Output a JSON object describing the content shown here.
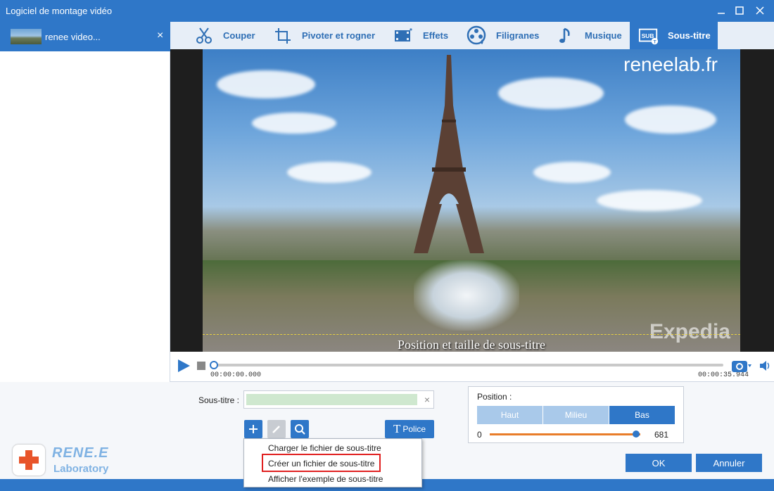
{
  "window": {
    "title": "Logiciel de montage vidéo"
  },
  "file_tab": {
    "name": "renee video...",
    "close": "×"
  },
  "toolbar": {
    "items": [
      {
        "label": "Couper",
        "icon": "scissors-icon"
      },
      {
        "label": "Pivoter et rogner",
        "icon": "crop-icon"
      },
      {
        "label": "Effets",
        "icon": "effects-icon"
      },
      {
        "label": "Filigranes",
        "icon": "watermark-icon"
      },
      {
        "label": "Musique",
        "icon": "music-icon"
      },
      {
        "label": "Sous-titre",
        "icon": "subtitle-icon",
        "active": true
      }
    ]
  },
  "video": {
    "watermark": "reneelab.fr",
    "brand_overlay": "Expedia",
    "subtitle_preview": "Position et taille de sous-titre"
  },
  "player": {
    "current_time": "00:00:00.000",
    "total_time": "00:00:35.944",
    "progress": 0
  },
  "subtitle_panel": {
    "label": "Sous-titre :",
    "value": "",
    "clear": "×",
    "police_label": "Police",
    "police_glyph": "T"
  },
  "position_panel": {
    "label": "Position :",
    "options": [
      "Haut",
      "Milieu",
      "Bas"
    ],
    "selected": "Bas",
    "min": "0",
    "max": "681",
    "value_fraction": 0.97
  },
  "context_menu": {
    "items": [
      "Charger le fichier de sous-titre",
      "Créer un fichier de sous-titre",
      "Afficher l'exemple de sous-titre"
    ],
    "highlighted_index": 1
  },
  "logo": {
    "brand": "RENE.E",
    "sub": "Laboratory"
  },
  "buttons": {
    "ok": "OK",
    "cancel": "Annuler"
  },
  "colors": {
    "accent": "#2f77c8",
    "slider": "#e87d2a",
    "highlight": "#e02020"
  }
}
